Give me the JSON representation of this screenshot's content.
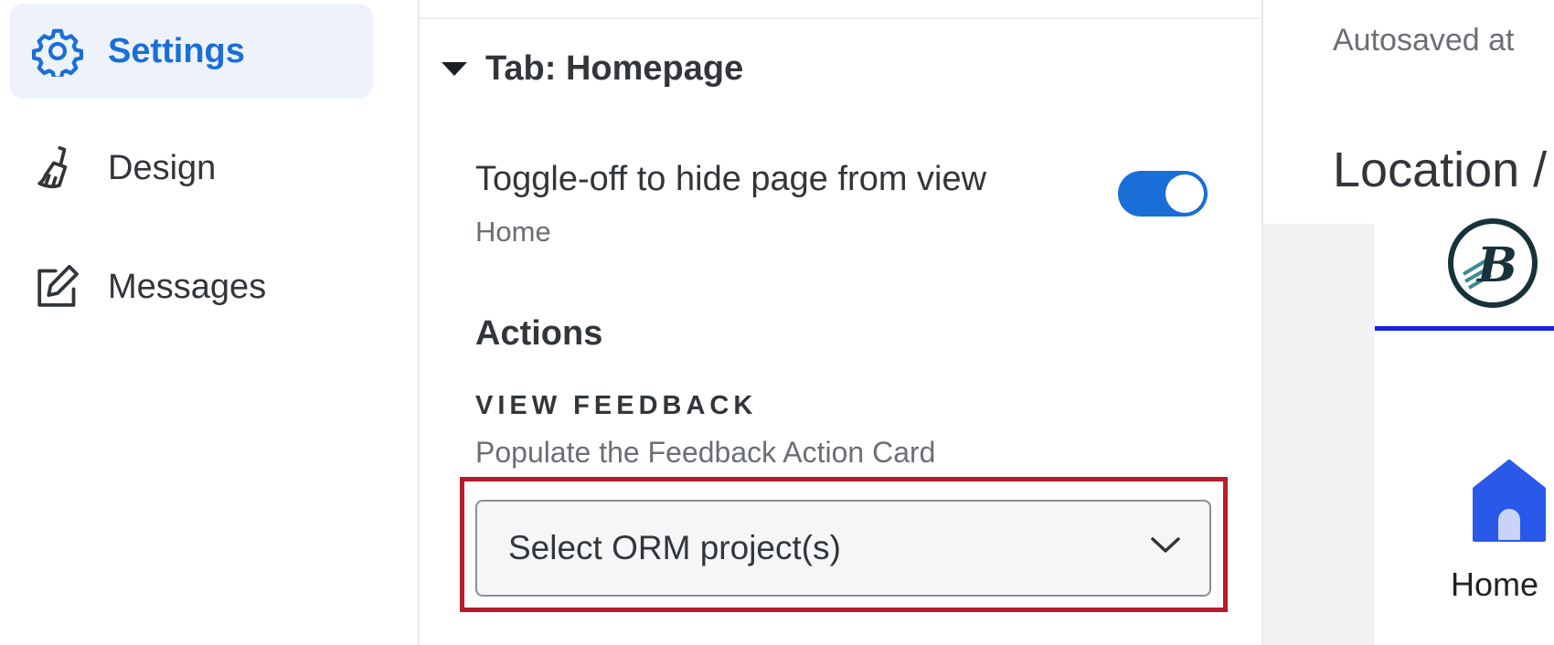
{
  "nav": {
    "items": [
      {
        "label": "Settings",
        "icon": "gear-icon",
        "active": true
      },
      {
        "label": "Design",
        "icon": "paintbrush-icon",
        "active": false
      },
      {
        "label": "Messages",
        "icon": "edit-message-icon",
        "active": false
      }
    ]
  },
  "panel": {
    "tab_title": "Tab: Homepage",
    "toggle": {
      "label": "Toggle-off to hide page from view",
      "sublabel": "Home",
      "on": true
    },
    "actions_heading": "Actions",
    "view_feedback": {
      "heading": "VIEW FEEDBACK",
      "description": "Populate the Feedback Action Card",
      "select_value": "Select ORM project(s)"
    }
  },
  "preview": {
    "autosave_text": "Autosaved at",
    "location_text": "Location /",
    "logo_letter": "B",
    "home_label": "Home"
  },
  "colors": {
    "accent": "#1a6ed8",
    "highlight": "#b81c2b",
    "active_bg": "#eef3fb",
    "preview_line": "#1a1ee0"
  }
}
